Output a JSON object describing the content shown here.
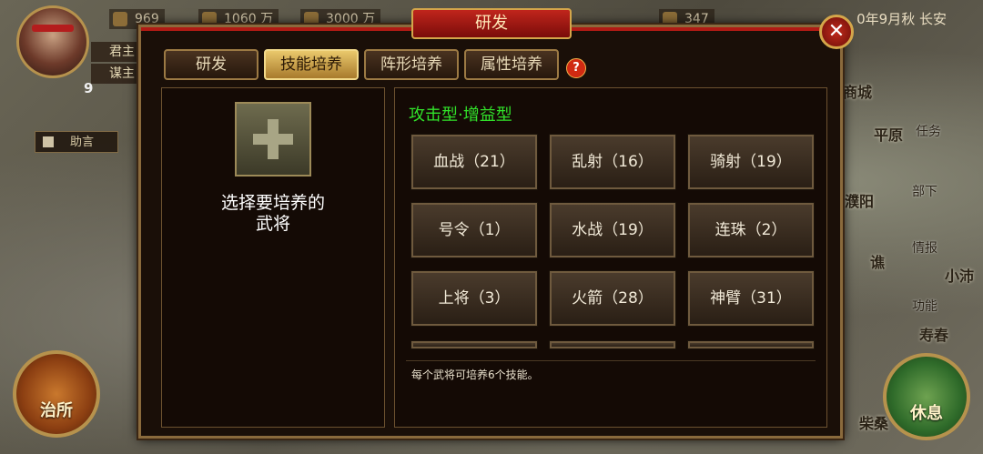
{
  "hud": {
    "level": "9",
    "lord_label": "君主",
    "advisor_label": "谋主",
    "resources": [
      {
        "icon": "rice-icon",
        "value": "969"
      },
      {
        "icon": "coin-icon",
        "value": "1060 万"
      },
      {
        "icon": "wood-icon",
        "value": "3000 万"
      },
      {
        "icon": "order-icon",
        "value": "347"
      }
    ],
    "date": "0年9月秋 长安",
    "helper_label": "助言",
    "government_label": "治所",
    "rest_label": "休息"
  },
  "map": {
    "cities": [
      "商城",
      "平原",
      "濮阳",
      "谯",
      "小沛",
      "寿春",
      "柴桑"
    ],
    "menu": [
      "任务",
      "部下",
      "情报",
      "功能"
    ]
  },
  "dialog": {
    "title": "研发",
    "close_glyph": "✕",
    "tabs": [
      "研发",
      "技能培养",
      "阵形培养",
      "属性培养"
    ],
    "active_tab": 1,
    "help_glyph": "?",
    "choose_general": "选择要培养的武将",
    "section_title": "攻击型·增益型",
    "skills": [
      "血战（21）",
      "乱射（16）",
      "骑射（19）",
      "号令（1）",
      "水战（19）",
      "连珠（2）",
      "上将（3）",
      "火箭（28）",
      "神臂（31）"
    ],
    "note": "每个武将可培养6个技能。"
  }
}
